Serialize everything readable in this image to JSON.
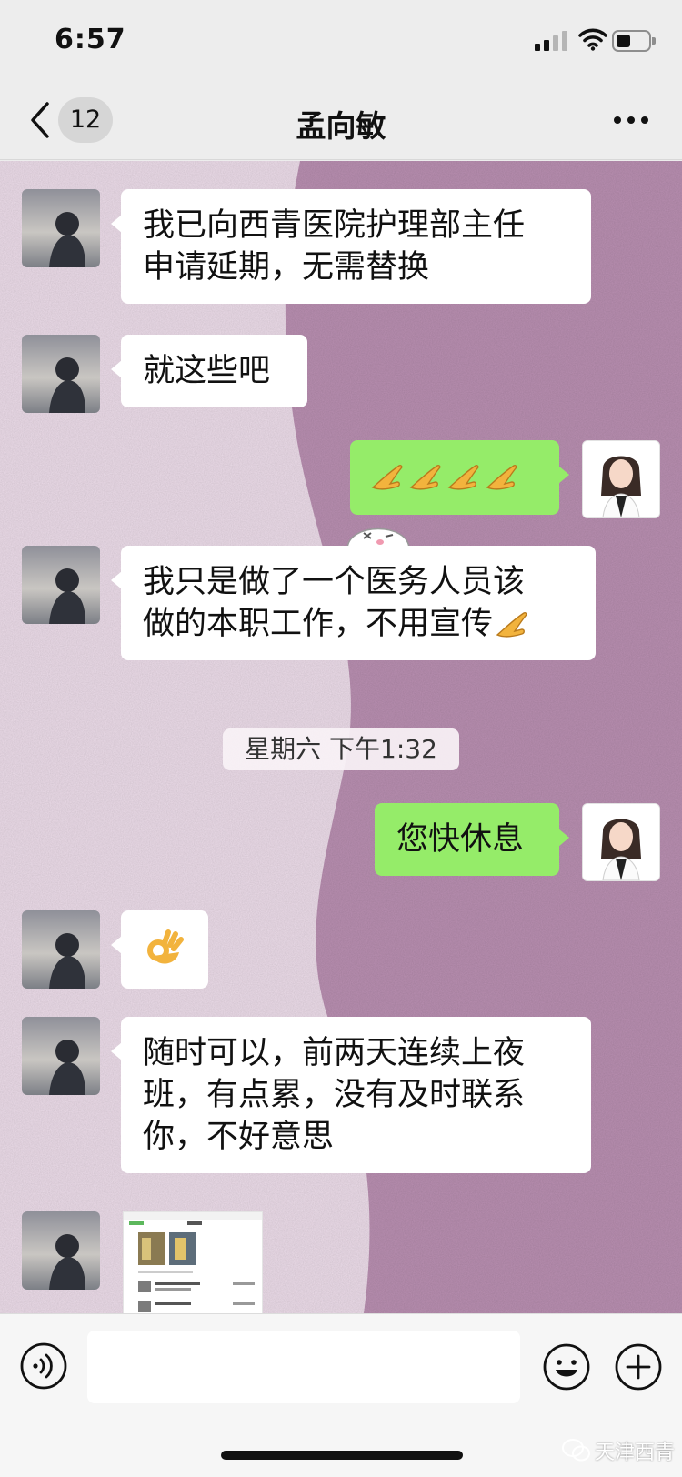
{
  "status_bar": {
    "time": "6:57"
  },
  "nav": {
    "unread_count": "12",
    "title": "孟向敏"
  },
  "messages": [
    {
      "from": "contact",
      "lines": [
        "我已向西青医院护理部主任",
        "申请延期，无需替换"
      ]
    },
    {
      "from": "contact",
      "text": "就这些吧"
    },
    {
      "from": "me",
      "emoji": [
        "pinched-hand-emoji",
        "pinched-hand-emoji",
        "pinched-hand-emoji",
        "pinched-hand-emoji"
      ]
    },
    {
      "from": "contact",
      "lines": [
        "我只是做了一个医务人员该",
        "做的本职工作，不用宣传"
      ],
      "trailing_emoji": "pinched-hand-emoji"
    },
    {
      "type": "timestamp",
      "text": "星期六 下午1:32"
    },
    {
      "from": "me",
      "text": "您快休息"
    },
    {
      "from": "contact",
      "emoji": [
        "ok-hand-emoji"
      ]
    },
    {
      "from": "contact",
      "lines": [
        "随时可以，前两天连续上夜",
        "班，有点累，没有及时联系",
        "你，不好意思"
      ]
    },
    {
      "from": "contact",
      "type": "image",
      "icon": "screenshot-thumbnail"
    }
  ],
  "input_bar": {
    "value": "",
    "placeholder": "",
    "icons": [
      "voice-icon",
      "emoji-icon",
      "add-icon"
    ]
  },
  "watermark": {
    "text": "天津西青"
  },
  "colors": {
    "outgoing_bubble": "#95ec69",
    "incoming_bubble": "#ffffff",
    "chat_background_light": "#ecdce9",
    "chat_background_wave": "#b98fb1",
    "bars": "#ededed"
  }
}
